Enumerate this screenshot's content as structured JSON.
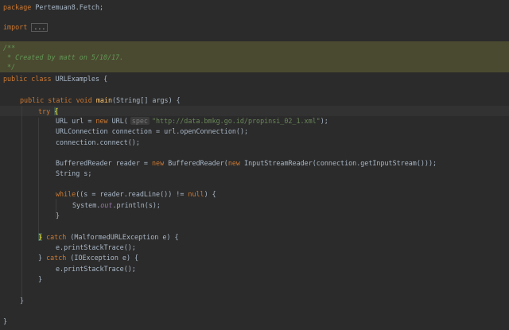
{
  "editor": {
    "theme": "darcula",
    "colors": {
      "background": "#2b2b2b",
      "keyword": "#cc7832",
      "string": "#6a8759",
      "comment": "#629755",
      "method_decl": "#ffc66d",
      "static_field": "#9876aa",
      "comment_highlight": "#4a4a30"
    },
    "lines": {
      "l1": {
        "kw": "package",
        "text": " Pertemuan8.Fetch;"
      },
      "l2": {
        "kw": "import",
        "fold": "..."
      },
      "l3": {
        "text": "/**"
      },
      "l4": {
        "text": " * Created by matt on 5/10/17."
      },
      "l5": {
        "text": " */"
      },
      "l6": {
        "kw": "public class",
        "text": " URLExamples {"
      },
      "l7": {
        "kw": "public static void",
        "fn": "main",
        "text": "(String[] args) {"
      },
      "l8": {
        "kw": "try",
        "brace": "{"
      },
      "l9": {
        "a": "URL url = ",
        "kw": "new",
        "b": " URL(",
        "hint": "spec",
        "str": "\"http://data.bmkg.go.id/propinsi_02_1.xml\"",
        "c": ");"
      },
      "l10": {
        "text": "URLConnection connection = url.openConnection();"
      },
      "l11": {
        "text": "connection.connect();"
      },
      "l12": {
        "a": "BufferedReader reader = ",
        "kw1": "new",
        "b": " BufferedReader(",
        "kw2": "new",
        "c": " InputStreamReader(connection.getInputStream()));"
      },
      "l13": {
        "text": "String s;"
      },
      "l14": {
        "kw1": "while",
        "a": "((s = reader.readLine()) != ",
        "kw2": "null",
        "b": ") {"
      },
      "l15": {
        "a": "System.",
        "fld": "out",
        "b": ".println(s);"
      },
      "l16": {
        "text": "}"
      },
      "l17": {
        "brace": "}",
        "kw": "catch",
        "text": " (MalformedURLException e) {"
      },
      "l18": {
        "text": "e.printStackTrace();"
      },
      "l19": {
        "a": "} ",
        "kw": "catch",
        "text": " (IOException e) {"
      },
      "l20": {
        "text": "e.printStackTrace();"
      },
      "l21": {
        "text": "}"
      },
      "l22": {
        "text": "}"
      },
      "l23": {
        "text": "}"
      }
    }
  }
}
